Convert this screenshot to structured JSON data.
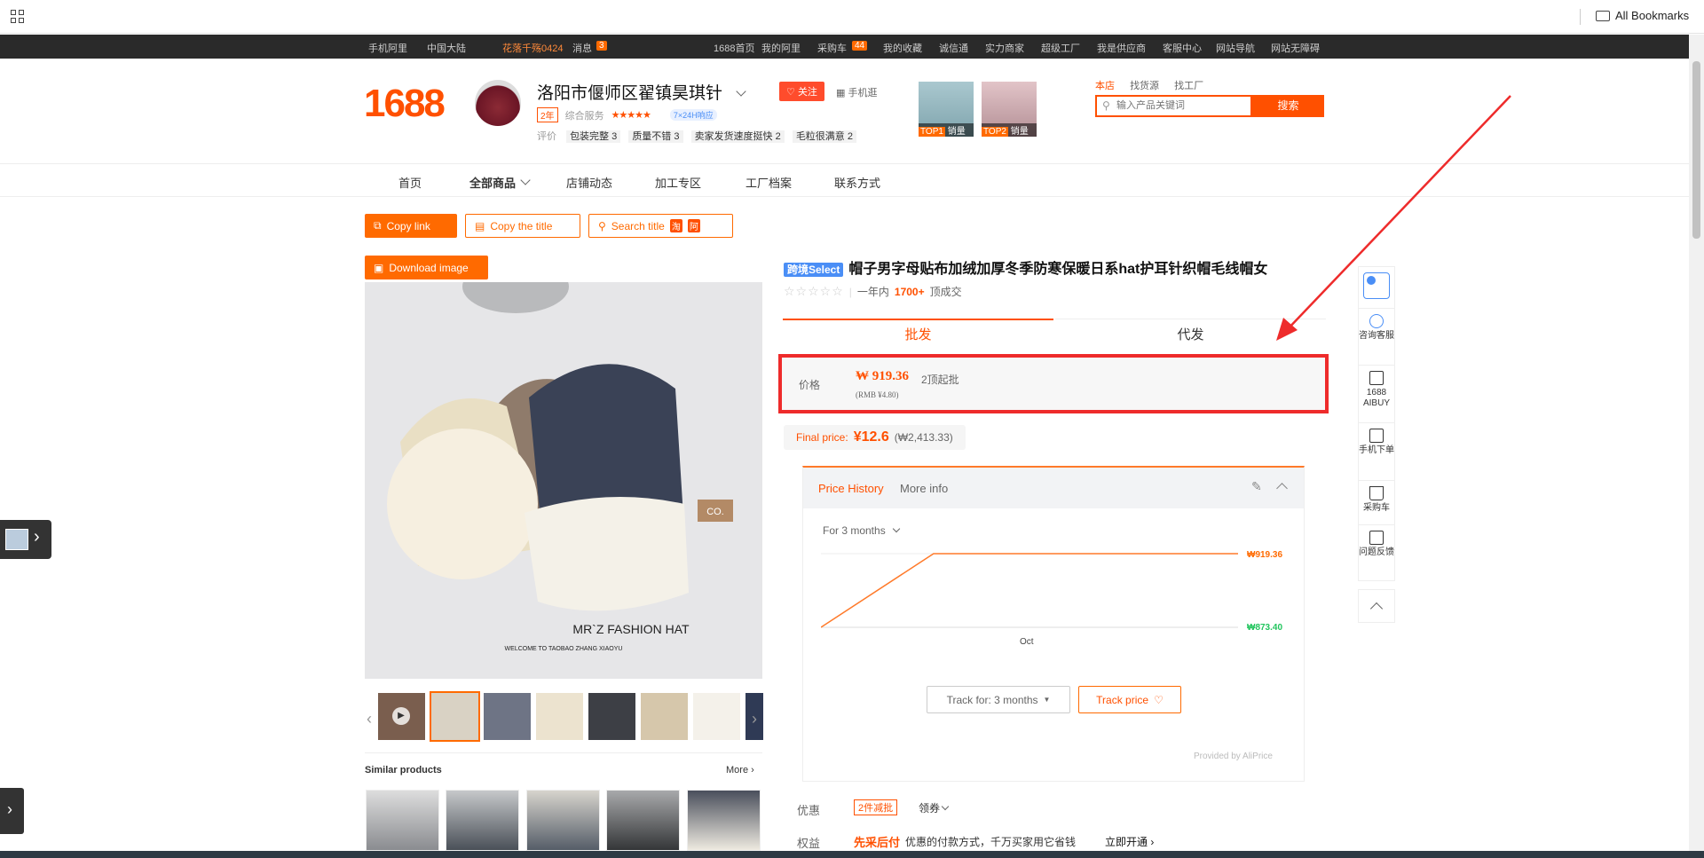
{
  "browser": {
    "all_bookmarks": "All Bookmarks"
  },
  "topnav": {
    "left": [
      "手机阿里",
      "中国大陆",
      "花落千殇0424",
      "消息"
    ],
    "msg_count": "3",
    "cart_count": "44",
    "right": [
      "1688首页",
      "我的阿里",
      "采购车",
      "我的收藏",
      "诚信通",
      "实力商家",
      "超级工厂",
      "我是供应商",
      "客服中心",
      "网站导航",
      "网站无障碍"
    ]
  },
  "header": {
    "logo": "1688",
    "shop_name": "洛阳市偃师区翟镇昊琪针",
    "years_tag": "2年",
    "service_label": "综合服务",
    "service_badge": "7×24H响应",
    "follow": "关注",
    "mobile": "手机逛",
    "reviews_label": "评价",
    "reviews": [
      "包装完整 3",
      "质量不错 3",
      "卖家发货速度挺快 2",
      "毛粒很满意 2"
    ],
    "top_products": [
      {
        "rank": "TOP1",
        "label": "销量"
      },
      {
        "rank": "TOP2",
        "label": "销量"
      }
    ],
    "search_tabs": [
      "本店",
      "找货源",
      "找工厂"
    ],
    "search_placeholder": "输入产品关键词",
    "search_button": "搜索"
  },
  "shop_nav": [
    "首页",
    "全部商品",
    "店铺动态",
    "加工专区",
    "工厂档案",
    "联系方式"
  ],
  "actions": {
    "copy_link": "Copy link",
    "copy_title": "Copy the title",
    "search_title": "Search title",
    "download_image": "Download image"
  },
  "image_text": {
    "brand": "MR`Z FASHION HAT",
    "sub": "WELCOME TO TAOBAO ZHANG XIAOYU",
    "label": "CO."
  },
  "similar": {
    "title": "Similar products",
    "more": "More"
  },
  "product": {
    "badge": "跨境Select",
    "title": "帽子男字母贴布加绒加厚冬季防寒保暖日系hat护耳针织帽毛线帽女",
    "sales_prefix": "一年内",
    "sales_count": "1700+",
    "sales_suffix": "顶成交",
    "tab_wholesale": "批发",
    "tab_dropship": "代发",
    "price_label": "价格",
    "price": "₩ 919.36",
    "moq": "2顶起批",
    "rmb": "(RMB ¥4.80)",
    "final_label": "Final price:",
    "final_price": "¥12.6",
    "final_krw": "(₩2,413.33)"
  },
  "history": {
    "tab_active": "Price History",
    "tab_other": "More info",
    "range": "For 3 months",
    "high_label": "₩919.36",
    "low_label": "₩873.40",
    "x_label": "Oct",
    "track_for": "Track for: 3 months",
    "track_price": "Track price",
    "provided": "Provided by AliPrice",
    "colors": {
      "line": "#ff7a2a",
      "high": "#ff6a00",
      "low": "#22c55e"
    }
  },
  "chart_data": {
    "type": "line",
    "x": [
      "",
      "",
      "Oct",
      "",
      ""
    ],
    "series": [
      {
        "values": [
          873.4,
          919.36,
          919.36,
          919.36,
          919.36
        ]
      }
    ],
    "low": 873.4,
    "high": 919.36
  },
  "sidebar": [
    "咨询客服",
    "1688 AIBUY",
    "手机下单",
    "采购车",
    "问题反馈"
  ],
  "bottom": {
    "discount_label": "优惠",
    "discount_tag": "2件减批",
    "coupon": "领券",
    "rights_label": "权益",
    "rights_name": "先采后付",
    "rights_desc": "优惠的付款方式，千万买家用它省钱",
    "open_now": "立即开通"
  }
}
